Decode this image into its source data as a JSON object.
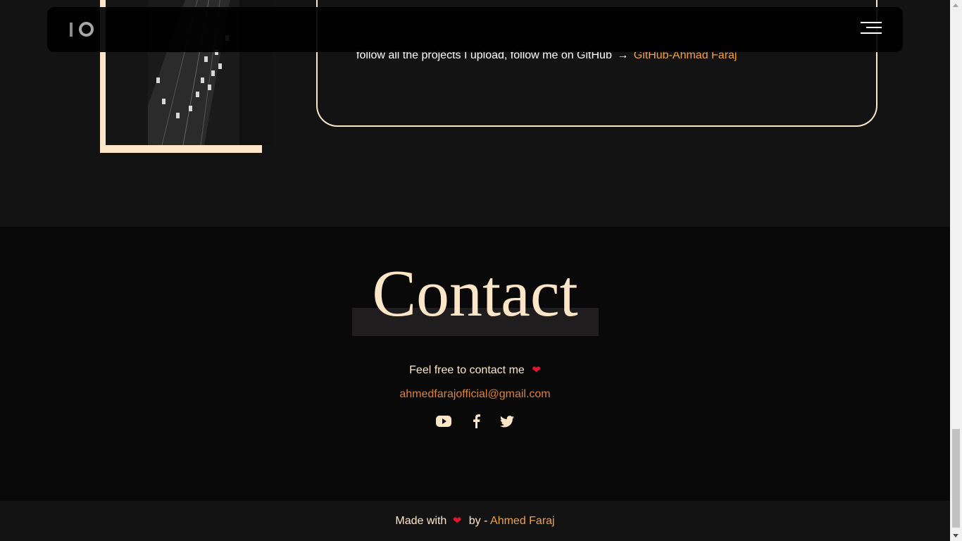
{
  "nav": {
    "logo_text": "IO",
    "menu_icon": "hamburger-menu-icon"
  },
  "about": {
    "text_prefix": "follow all the projects I upload, follow me on GitHub",
    "arrow": "→",
    "github_link": "GitHub-Ahmad Faraj",
    "photo_icon": "city-highway-photo"
  },
  "contact": {
    "title": "Contact",
    "subtitle": "Feel free to contact me",
    "heart": "❤",
    "email": "ahmedfarajofficial@gmail.com",
    "socials": [
      {
        "name": "youtube",
        "icon": "youtube-icon"
      },
      {
        "name": "facebook",
        "icon": "facebook-icon"
      },
      {
        "name": "twitter",
        "icon": "twitter-icon"
      }
    ]
  },
  "footer": {
    "prefix": "Made with",
    "heart": "❤",
    "by": "by -",
    "author": "Ahmed Faraj"
  },
  "colors": {
    "accent": "#fde6c7",
    "link": "#f0a04a",
    "heart": "#e0162b",
    "background": "#141314",
    "contact_bg": "#0a090a"
  }
}
